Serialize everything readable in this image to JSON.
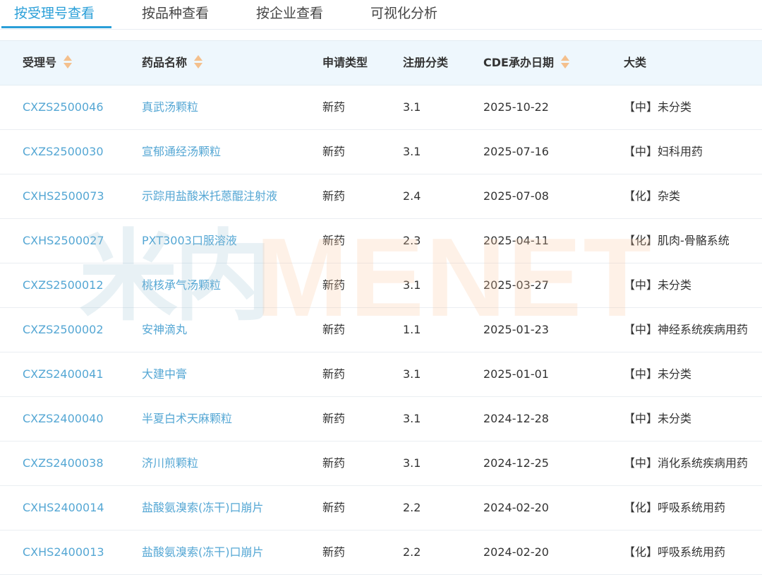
{
  "tabs": [
    {
      "label": "按受理号查看",
      "active": true
    },
    {
      "label": "按品种查看",
      "active": false
    },
    {
      "label": "按企业查看",
      "active": false
    },
    {
      "label": "可视化分析",
      "active": false
    }
  ],
  "table": {
    "headers": {
      "accept_no": "受理号",
      "drug_name": "药品名称",
      "app_type": "申请类型",
      "reg_class": "注册分类",
      "cde_date": "CDE承办日期",
      "category": "大类"
    },
    "rows": [
      {
        "accept_no": "CXZS2500046",
        "drug_name": "真武汤颗粒",
        "app_type": "新药",
        "reg_class": "3.1",
        "cde_date": "2025-10-22",
        "category": "【中】未分类"
      },
      {
        "accept_no": "CXZS2500030",
        "drug_name": "宣郁通经汤颗粒",
        "app_type": "新药",
        "reg_class": "3.1",
        "cde_date": "2025-07-16",
        "category": "【中】妇科用药"
      },
      {
        "accept_no": "CXHS2500073",
        "drug_name": "示踪用盐酸米托蒽醌注射液",
        "app_type": "新药",
        "reg_class": "2.4",
        "cde_date": "2025-07-08",
        "category": "【化】杂类"
      },
      {
        "accept_no": "CXHS2500027",
        "drug_name": "PXT3003口服溶液",
        "app_type": "新药",
        "reg_class": "2.3",
        "cde_date": "2025-04-11",
        "category": "【化】肌肉-骨骼系统"
      },
      {
        "accept_no": "CXZS2500012",
        "drug_name": "桃核承气汤颗粒",
        "app_type": "新药",
        "reg_class": "3.1",
        "cde_date": "2025-03-27",
        "category": "【中】未分类"
      },
      {
        "accept_no": "CXZS2500002",
        "drug_name": "安神滴丸",
        "app_type": "新药",
        "reg_class": "1.1",
        "cde_date": "2025-01-23",
        "category": "【中】神经系统疾病用药"
      },
      {
        "accept_no": "CXZS2400041",
        "drug_name": "大建中膏",
        "app_type": "新药",
        "reg_class": "3.1",
        "cde_date": "2025-01-01",
        "category": "【中】未分类"
      },
      {
        "accept_no": "CXZS2400040",
        "drug_name": "半夏白术天麻颗粒",
        "app_type": "新药",
        "reg_class": "3.1",
        "cde_date": "2024-12-28",
        "category": "【中】未分类"
      },
      {
        "accept_no": "CXZS2400038",
        "drug_name": "济川煎颗粒",
        "app_type": "新药",
        "reg_class": "3.1",
        "cde_date": "2024-12-25",
        "category": "【中】消化系统疾病用药"
      },
      {
        "accept_no": "CXHS2400014",
        "drug_name": "盐酸氨溴索(冻干)口崩片",
        "app_type": "新药",
        "reg_class": "2.2",
        "cde_date": "2024-02-20",
        "category": "【化】呼吸系统用药"
      },
      {
        "accept_no": "CXHS2400013",
        "drug_name": "盐酸氨溴索(冻干)口崩片",
        "app_type": "新药",
        "reg_class": "2.2",
        "cde_date": "2024-02-20",
        "category": "【化】呼吸系统用药"
      }
    ]
  },
  "watermark": {
    "cn": "米内",
    "en": "MENET"
  },
  "colors": {
    "accent": "#2a9fd8",
    "link": "#55a7d4",
    "header_bg": "#eef7fd",
    "sort_icon": "#f4c08d"
  }
}
